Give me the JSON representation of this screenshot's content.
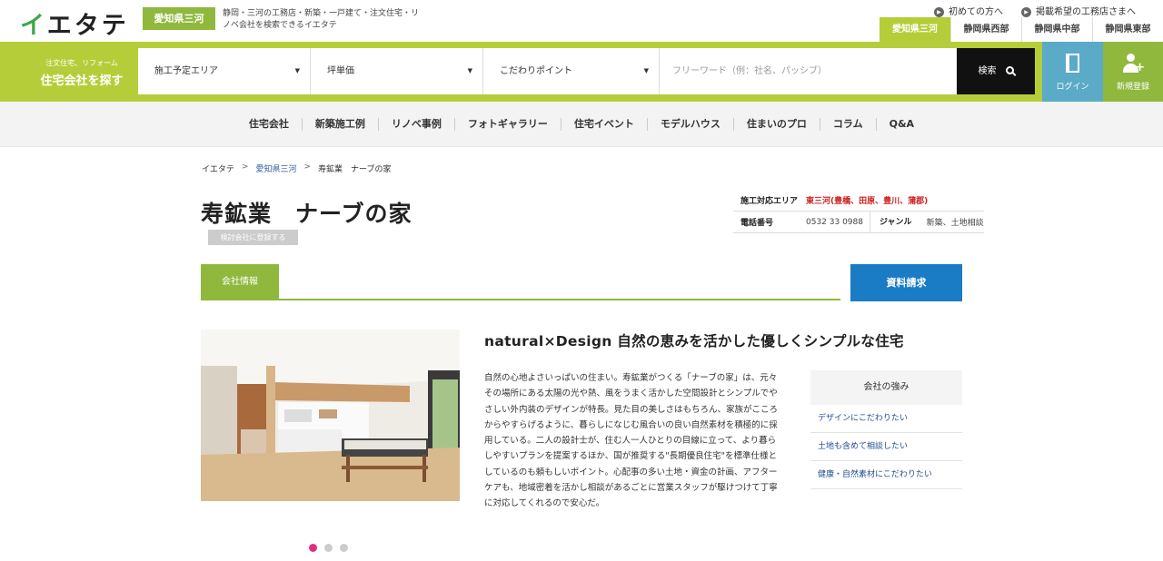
{
  "header": {
    "logo": "イエタテ",
    "region_badge": "愛知県三河",
    "tagline": "静岡・三河の工務店・新築・一戸建て・注文住宅・リノベ会社を検索できるイエタテ",
    "links": [
      "初めての方へ",
      "掲載希望の工務店さまへ"
    ],
    "region_tabs": [
      {
        "label": "愛知県三河",
        "active": true
      },
      {
        "label": "静岡県西部",
        "active": false
      },
      {
        "label": "静岡県中部",
        "active": false
      },
      {
        "label": "静岡県東部",
        "active": false
      }
    ]
  },
  "search": {
    "label_small": "注文住宅、リフォーム",
    "label_big": "住宅会社を探す",
    "area": "施工予定エリア",
    "price": "坪単価",
    "feature": "こだわりポイント",
    "freeword_placeholder": "フリーワード（例：社名、パッシブ）",
    "button": "検索",
    "login": "ログイン",
    "register": "新規登録"
  },
  "nav": [
    "住宅会社",
    "新築施工例",
    "リノベ事例",
    "フォトギャラリー",
    "住宅イベント",
    "モデルハウス",
    "住まいのプロ",
    "コラム",
    "Q&A"
  ],
  "breadcrumb": [
    "イエタテ",
    "愛知県三河",
    "寿鉱業　ナーブの家"
  ],
  "company": {
    "name": "寿鉱業　ナーブの家",
    "fav_button": "検討会社に登録する",
    "area_label": "施工対応エリア",
    "area_value": "東三河(豊橋、田原、豊川、蒲郡)",
    "phone_label": "電話番号",
    "phone": "0532 33 0988",
    "genre_label": "ジャンル",
    "genre": "新築、土地相談"
  },
  "tabs": {
    "company_info": "会社情報",
    "request": "資料請求"
  },
  "content": {
    "headline": "natural×Design 自然の恵みを活かした優しくシンプルな住宅",
    "body": "自然の心地よさいっぱいの住まい。寿鉱業がつくる「ナーブの家」は、元々その場所にある太陽の光や熱、風をうまく活かした空間設計とシンプルでやさしい外内装のデザインが特長。見た目の美しさはもちろん、家族がこころからやすらげるように、暮らしになじむ風合いの良い自然素材を積極的に採用している。二人の設計士が、住む人一人ひとりの目線に立って、より暮らしやすいプランを提案するほか、国が推奨する\"長期優良住宅\"を標準仕様としているのも頼もしいポイント。心配事の多い土地・資金の計画、アフターケアも、地域密着を活かし相談があるごとに営業スタッフが駆けつけて丁寧に対応してくれるので安心だ。",
    "strengths_title": "会社の強み",
    "strengths": [
      "デザインにこだわりたい",
      "土地も含めて相談したい",
      "健康・自然素材にこだわりたい"
    ]
  },
  "slider": {
    "count": 3,
    "active": 1
  },
  "colors": {
    "green": "#b6cd3a",
    "dark_green": "#8fb83d",
    "blue": "#1a7cc4",
    "pink": "#e0307e"
  }
}
